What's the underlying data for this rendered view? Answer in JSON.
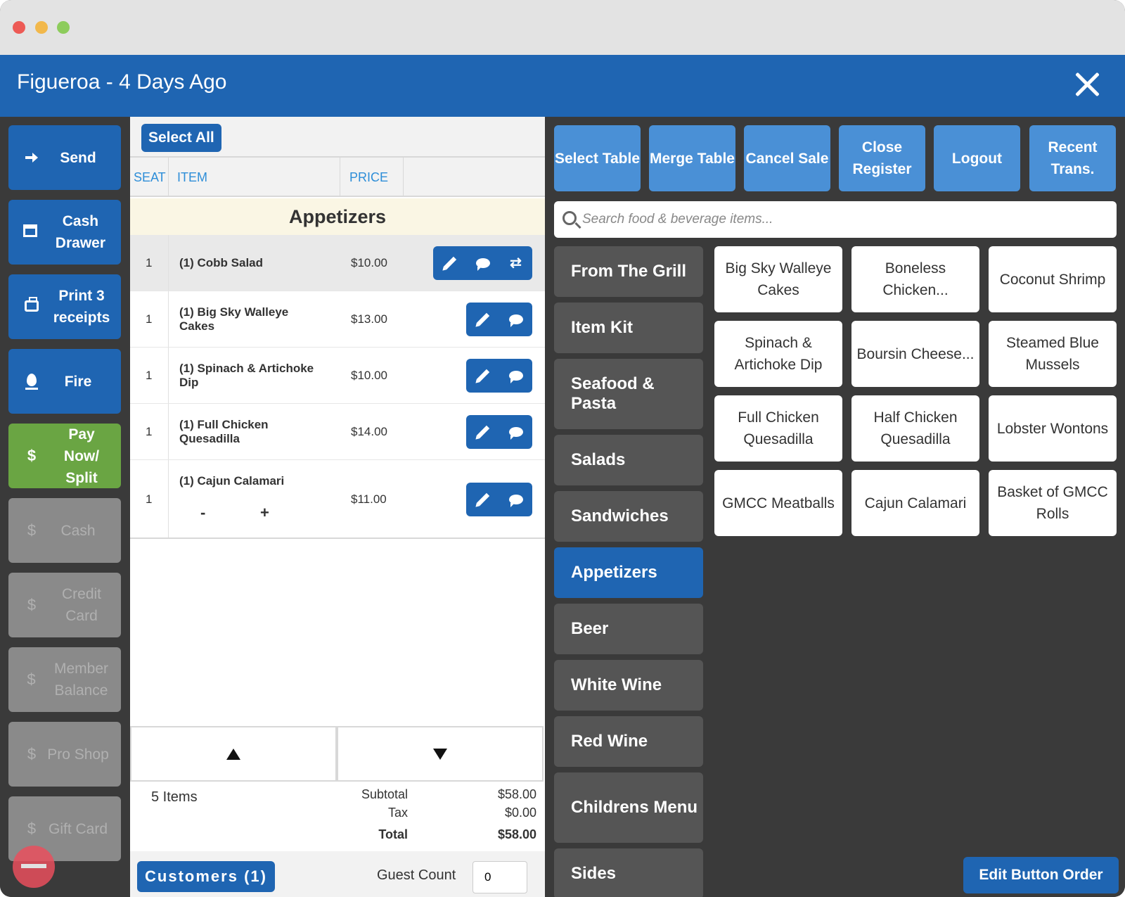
{
  "window": {
    "title": "Figueroa - 4 Days Ago"
  },
  "left_actions": [
    {
      "label": "Send",
      "icon": "arrow-right-icon",
      "enabled": true
    },
    {
      "label": "Cash Drawer",
      "icon": "drawer-icon",
      "enabled": true
    },
    {
      "label": "Print 3 receipts",
      "icon": "printer-icon",
      "enabled": true
    },
    {
      "label": "Fire",
      "icon": "fire-icon",
      "enabled": true
    },
    {
      "label": "Pay Now/ Split",
      "icon": "dollar-icon",
      "enabled": true
    },
    {
      "label": "Cash",
      "icon": "dollar-icon",
      "enabled": false
    },
    {
      "label": "Credit Card",
      "icon": "dollar-icon",
      "enabled": false
    },
    {
      "label": "Member Balance",
      "icon": "dollar-icon",
      "enabled": false
    },
    {
      "label": "Pro Shop",
      "icon": "dollar-icon",
      "enabled": false
    },
    {
      "label": "Gift Card",
      "icon": "dollar-icon",
      "enabled": false
    }
  ],
  "dollar_glyph": "$",
  "ticket": {
    "select_all": "Select All",
    "columns": {
      "seat": "SEAT",
      "item": "ITEM",
      "price": "PRICE"
    },
    "category": "Appetizers",
    "rows": [
      {
        "seat": "1",
        "item": "(1) Cobb Salad",
        "price": "$10.00"
      },
      {
        "seat": "1",
        "item": "(1) Big Sky Walleye Cakes",
        "price": "$13.00"
      },
      {
        "seat": "1",
        "item": "(1) Spinach & Artichoke Dip",
        "price": "$10.00"
      },
      {
        "seat": "1",
        "item": "(1) Full Chicken Quesadilla",
        "price": "$14.00"
      },
      {
        "seat": "1",
        "item": "(1) Cajun Calamari",
        "price": "$11.00"
      }
    ],
    "qty_minus": "-",
    "qty_plus": "+",
    "summary": {
      "count": "5 Items",
      "subtotal_label": "Subtotal",
      "subtotal": "$58.00",
      "tax_label": "Tax",
      "tax": "$0.00",
      "total_label": "Total",
      "total": "$58.00"
    },
    "customers": "Customers (1)",
    "guest_count_label": "Guest Count",
    "guest_count": "0"
  },
  "top_buttons": [
    "Select Table",
    "Merge Table",
    "Cancel Sale",
    "Close Register",
    "Logout",
    "Recent Trans."
  ],
  "search": {
    "placeholder": "Search food & beverage items..."
  },
  "categories": [
    "From The Grill",
    "Item Kit",
    "Seafood & Pasta",
    "Salads",
    "Sandwiches",
    "Appetizers",
    "Beer",
    "White Wine",
    "Red Wine",
    "Childrens Menu",
    "Sides"
  ],
  "active_category": "Appetizers",
  "menu_items": [
    "Big Sky Walleye Cakes",
    "Boneless Chicken...",
    "Coconut Shrimp",
    "Spinach & Artichoke Dip",
    "Boursin Cheese...",
    "Steamed Blue Mussels",
    "Full Chicken Quesadilla",
    "Half Chicken Quesadilla",
    "Lobster Wontons",
    "GMCC Meatballs",
    "Cajun Calamari",
    "Basket of GMCC Rolls"
  ],
  "edit_button_order": "Edit Button Order",
  "colors": {
    "header_blue": "#1f65b2",
    "light_blue": "#4a90d6",
    "pay_green": "#6aa543",
    "dark_bg": "#3a3a3a",
    "category_gray": "#555555"
  }
}
